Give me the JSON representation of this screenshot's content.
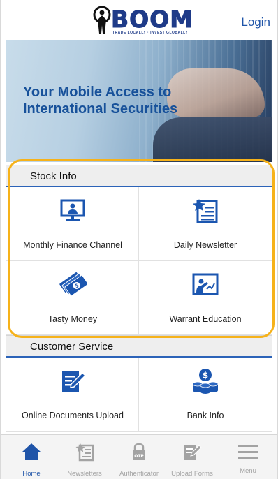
{
  "header": {
    "logo_text": "BOOM",
    "logo_tagline": "TRADE LOCALLY · INVEST GLOBALLY",
    "login_label": "Login"
  },
  "banner": {
    "title": "Your Mobile Access to International Securities"
  },
  "sections": {
    "stock_info": {
      "title": "Stock Info",
      "items": [
        {
          "label": "Monthly Finance Channel",
          "icon": "monitor-presenter-icon"
        },
        {
          "label": "Daily Newsletter",
          "icon": "star-newsletter-icon"
        },
        {
          "label": "Tasty Money",
          "icon": "money-bills-icon"
        },
        {
          "label": "Warrant Education",
          "icon": "teacher-board-icon"
        }
      ]
    },
    "customer_service": {
      "title": "Customer Service",
      "items": [
        {
          "label": "Online Documents Upload",
          "icon": "document-edit-icon"
        },
        {
          "label": "Bank Info",
          "icon": "coins-stack-icon"
        }
      ]
    }
  },
  "tabbar": {
    "items": [
      {
        "label": "Home",
        "icon": "home-icon",
        "active": true
      },
      {
        "label": "Newsletters",
        "icon": "star-newsletter-icon",
        "active": false
      },
      {
        "label": "Authenticator",
        "icon": "otp-lock-icon",
        "active": false
      },
      {
        "label": "Upload Forms",
        "icon": "document-edit-icon",
        "active": false
      },
      {
        "label": "Menu",
        "icon": "hamburger-menu-icon",
        "active": false
      }
    ]
  },
  "colors": {
    "brand_blue": "#1f54a8",
    "icon_blue": "#1b56b0",
    "highlight": "#f6b21a",
    "inactive_gray": "#a3a3a3"
  }
}
